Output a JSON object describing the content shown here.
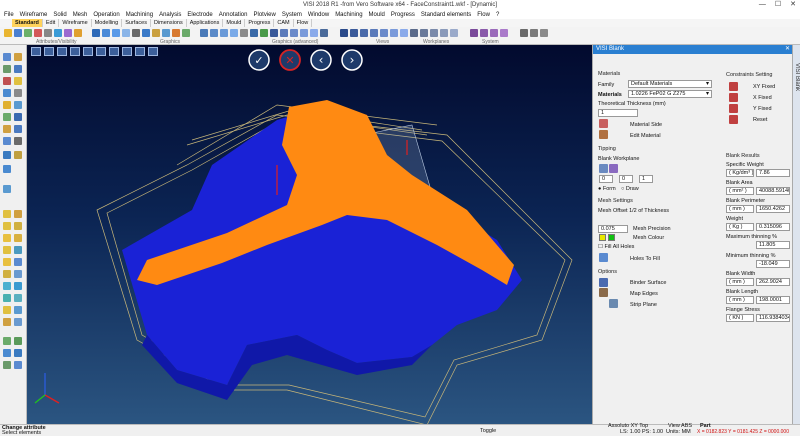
{
  "window": {
    "title": "VISI 2018 R1 -from Vero Software x64 - FaceConstraint1.wkf - [Dynamic]",
    "min": "—",
    "max": "☐",
    "close": "✕"
  },
  "menu": [
    "File",
    "Wireframe",
    "Solid",
    "Mesh",
    "Operation",
    "Machining",
    "Analysis",
    "Electrode",
    "Annotation",
    "Plotview",
    "System",
    "Window",
    "Machining",
    "Mould",
    "Progress",
    "Standard elements",
    "Flow",
    "?"
  ],
  "tabs": [
    "Standard",
    "Edit",
    "Wireframe",
    "Modelling",
    "Surfaces",
    "Dimensions",
    "Applications",
    "Mould",
    "Progress",
    "CAM",
    "Flow"
  ],
  "ribbon_groups": [
    "Attributes/Visibility",
    "Graphics",
    "Graphics (advanced)",
    "Views",
    "Workplanes",
    "System"
  ],
  "confirm": {
    "ok": "✓",
    "cancel": "✕",
    "prev": "‹",
    "next": "›"
  },
  "panel": {
    "title": "VISI Blank",
    "materials_header": "Materials",
    "family_label": "Family",
    "family_value": "Default Materials",
    "materials_label": "Materials",
    "materials_value": "1.0226 FeP02 G Z275",
    "thickness_label": "Theoretical Thickness (mm)",
    "thickness_value": "1",
    "material_side": "Material Side",
    "edit_material": "Edit Material",
    "tipping_header": "Tipping",
    "blank_workplane": "Blank Workplane",
    "wp_values": [
      "0",
      "0",
      "1"
    ],
    "radio_form": "Form",
    "radio_draw": "Draw",
    "mesh_header": "Mesh Settings",
    "mesh_offset": "Mesh Offset 1/2 of Thickness",
    "mesh_precision_value": "0.075",
    "mesh_precision": "Mesh Precision",
    "mesh_colour": "Mesh Colour",
    "fill_all_holes": "Fill All Holes",
    "holes_to_fill": "Holes To Fill",
    "options_header": "Options",
    "binder_surface": "Binder Surface",
    "map_edges": "Map Edges",
    "strip_plane": "Strip Plane",
    "constraints_header": "Constraints Setting",
    "xy_fixed": "XY Fixed",
    "x_fixed": "X Fixed",
    "y_fixed": "Y Fixed",
    "reset": "Reset",
    "results_header": "Blank Results",
    "specific_weight": "Specific Weight",
    "sw_unit": "( Kg/dm³ )",
    "sw_value": "7.86",
    "blank_area": "Blank Area",
    "area_unit": "( mm² )",
    "area_value": "40088.5914061",
    "blank_perimeter": "Blank Perimeter",
    "perim_unit": "( mm )",
    "perim_value": "1650.4262",
    "weight": "Weight",
    "weight_unit": "( Kg )",
    "weight_value": "0.315096",
    "max_thinning": "Maximum thinning %",
    "max_thinning_value": "11.805",
    "min_thinning": "Minimum thinning %",
    "min_thinning_value": "-18.049",
    "blank_width": "Blank Width",
    "width_unit": "( mm )",
    "width_value": "262.9024",
    "blank_length": "Blank Length",
    "length_unit": "( mm )",
    "length_value": "198.0001",
    "flange_stress": "Flange Stress",
    "fs_unit": "( KN )",
    "fs_value": "116.9384034"
  },
  "side_tab": "VISI Blank",
  "status": {
    "line1": "Change attribute",
    "line2": "Select elements",
    "toggle": "Toggle",
    "view": "Assoluto XY Top",
    "view2": "View ABS",
    "part": "Part",
    "ls": "LS: 1.00  PS: 1.00",
    "units": "Units: MM",
    "coords": "X = 0182.823 Y = 0181.425 Z = 0000.000"
  },
  "colors": {
    "accent": "#ffd35c",
    "panel_header": "#2a7fd1",
    "part_blue": "#1a22d6",
    "strip_orange": "#ff8a12",
    "ok_ring": "#ffffff",
    "cancel_ring": "#d42424"
  }
}
